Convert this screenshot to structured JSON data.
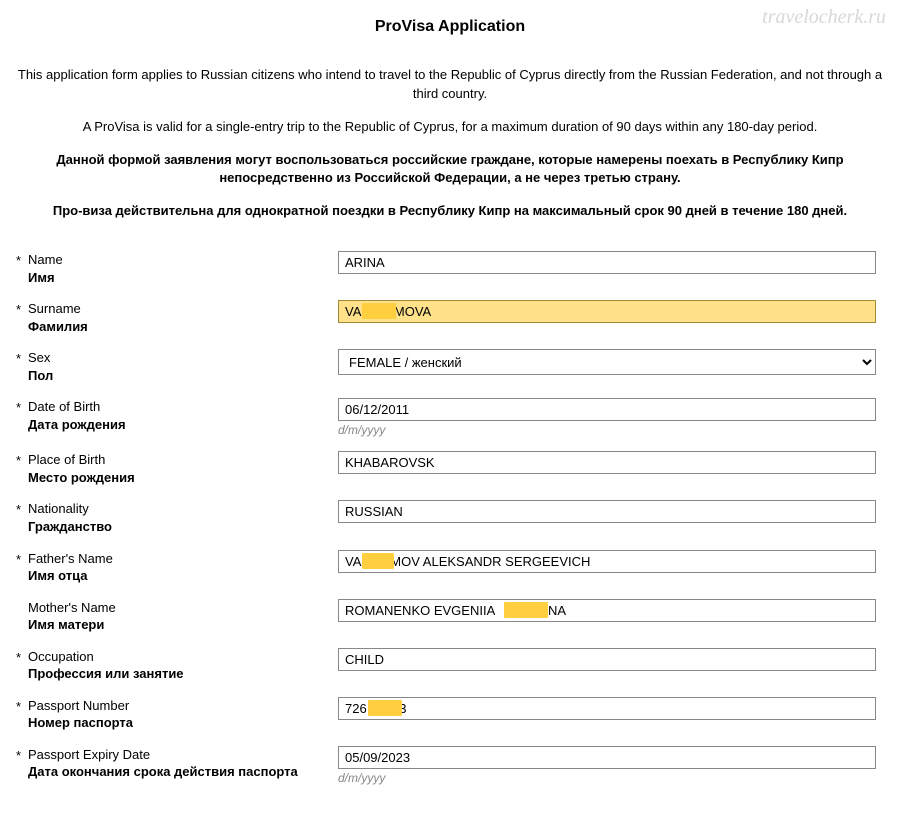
{
  "watermark": "travelocherk.ru",
  "title": "ProVisa Application",
  "intro": {
    "p1": "This application form applies to Russian citizens who intend to travel to the Republic of Cyprus directly from the Russian Federation, and not through a third country.",
    "p2": "A ProVisa is valid for a single-entry trip to the Republic of Cyprus, for a maximum duration of 90 days within any 180-day period.",
    "p3": "Данной формой заявления могут воспользоваться российские граждане, которые намерены поехать в Республику Кипр непосредственно из Российской Федерации, а не через третью страну.",
    "p4": "Про-виза действительна для однократной поездки в Республику Кипр на максимальный срок 90 дней в течение 180 дней."
  },
  "fields": {
    "name": {
      "star": "*",
      "en": "Name",
      "ru": "Имя",
      "value": "ARINA"
    },
    "surname": {
      "star": "*",
      "en": "Surname",
      "ru": "Фамилия",
      "value": "VA       AMOVA"
    },
    "sex": {
      "star": "*",
      "en": "Sex",
      "ru": "Пол",
      "value": "FEMALE / женский"
    },
    "dob": {
      "star": "*",
      "en": "Date of Birth",
      "ru": "Дата рождения",
      "value": "06/12/2011",
      "hint": "d/m/yyyy"
    },
    "pob": {
      "star": "*",
      "en": "Place of Birth",
      "ru": "Место рождения",
      "value": "KHABAROVSK"
    },
    "nationality": {
      "star": "*",
      "en": "Nationality",
      "ru": "Гражданство",
      "value": "RUSSIAN"
    },
    "father": {
      "star": "*",
      "en": "Father's Name",
      "ru": "Имя отца",
      "value": "VA      AMOV ALEKSANDR SERGEEVICH"
    },
    "mother": {
      "star": "",
      "en": "Mother's Name",
      "ru": "Имя матери",
      "value": "ROMANENKO EVGENIIA          EVNA"
    },
    "occupation": {
      "star": "*",
      "en": "Occupation",
      "ru": "Профессия или занятие",
      "value": "CHILD"
    },
    "passport": {
      "star": "*",
      "en": "Passport Number",
      "ru": "Номер паспорта",
      "value": "726       23"
    },
    "expiry": {
      "star": "*",
      "en": "Passport Expiry Date",
      "ru": "Дата окончания срока действия паспорта",
      "value": "05/09/2023",
      "hint": "d/m/yyyy"
    }
  }
}
